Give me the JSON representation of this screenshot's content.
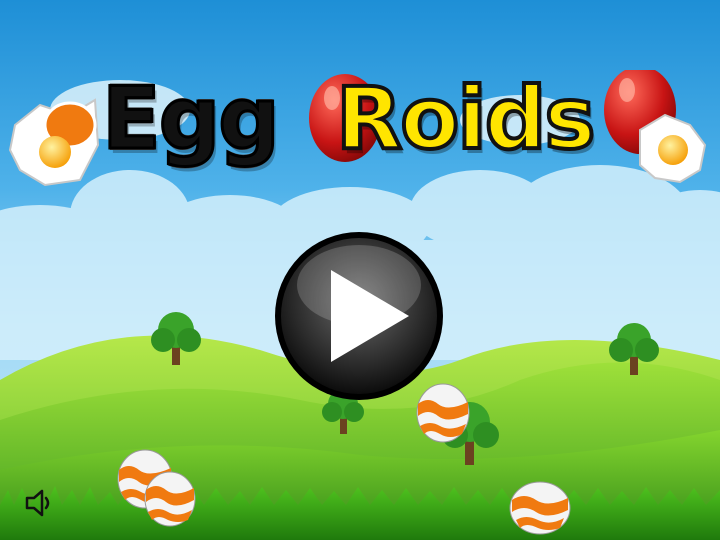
{
  "game": {
    "title_part1": "Egg",
    "title_part2": "Roids"
  },
  "controls": {
    "play": "play-icon",
    "sound": "speaker-icon"
  },
  "colors": {
    "sky_top": "#1e8fd6",
    "hill_green": "#6ccf2a",
    "title_yellow": "#ffe500",
    "egg_orange": "#f07a10"
  }
}
